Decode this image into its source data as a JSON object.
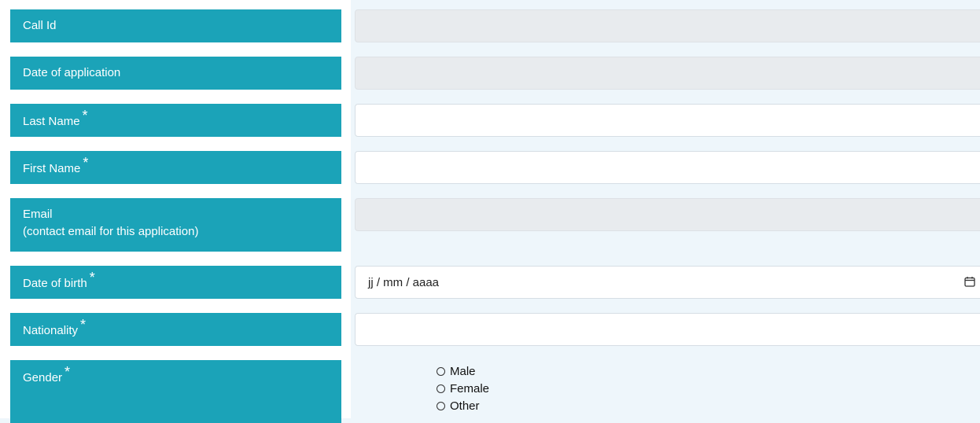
{
  "form": {
    "call_id": {
      "label": "Call Id",
      "value": ""
    },
    "date_of_application": {
      "label": "Date of application",
      "value": ""
    },
    "last_name": {
      "label": "Last Name",
      "required_mark": "*",
      "value": ""
    },
    "first_name": {
      "label": "First Name",
      "required_mark": "*",
      "value": ""
    },
    "email": {
      "label": "Email",
      "sublabel": "(contact email for this application)",
      "value": ""
    },
    "date_of_birth": {
      "label": "Date of birth",
      "required_mark": "*",
      "placeholder": "jj / mm / aaaa",
      "icon": "calendar-icon"
    },
    "nationality": {
      "label": "Nationality",
      "required_mark": "*",
      "value": ""
    },
    "gender": {
      "label": "Gender",
      "required_mark": "*",
      "options": [
        "Male",
        "Female",
        "Other"
      ]
    }
  },
  "colors": {
    "label_bg": "#1ba3b8",
    "label_text": "#ffffff",
    "disabled_field": "#e8ebee",
    "page_bg": "#eef6fb"
  }
}
